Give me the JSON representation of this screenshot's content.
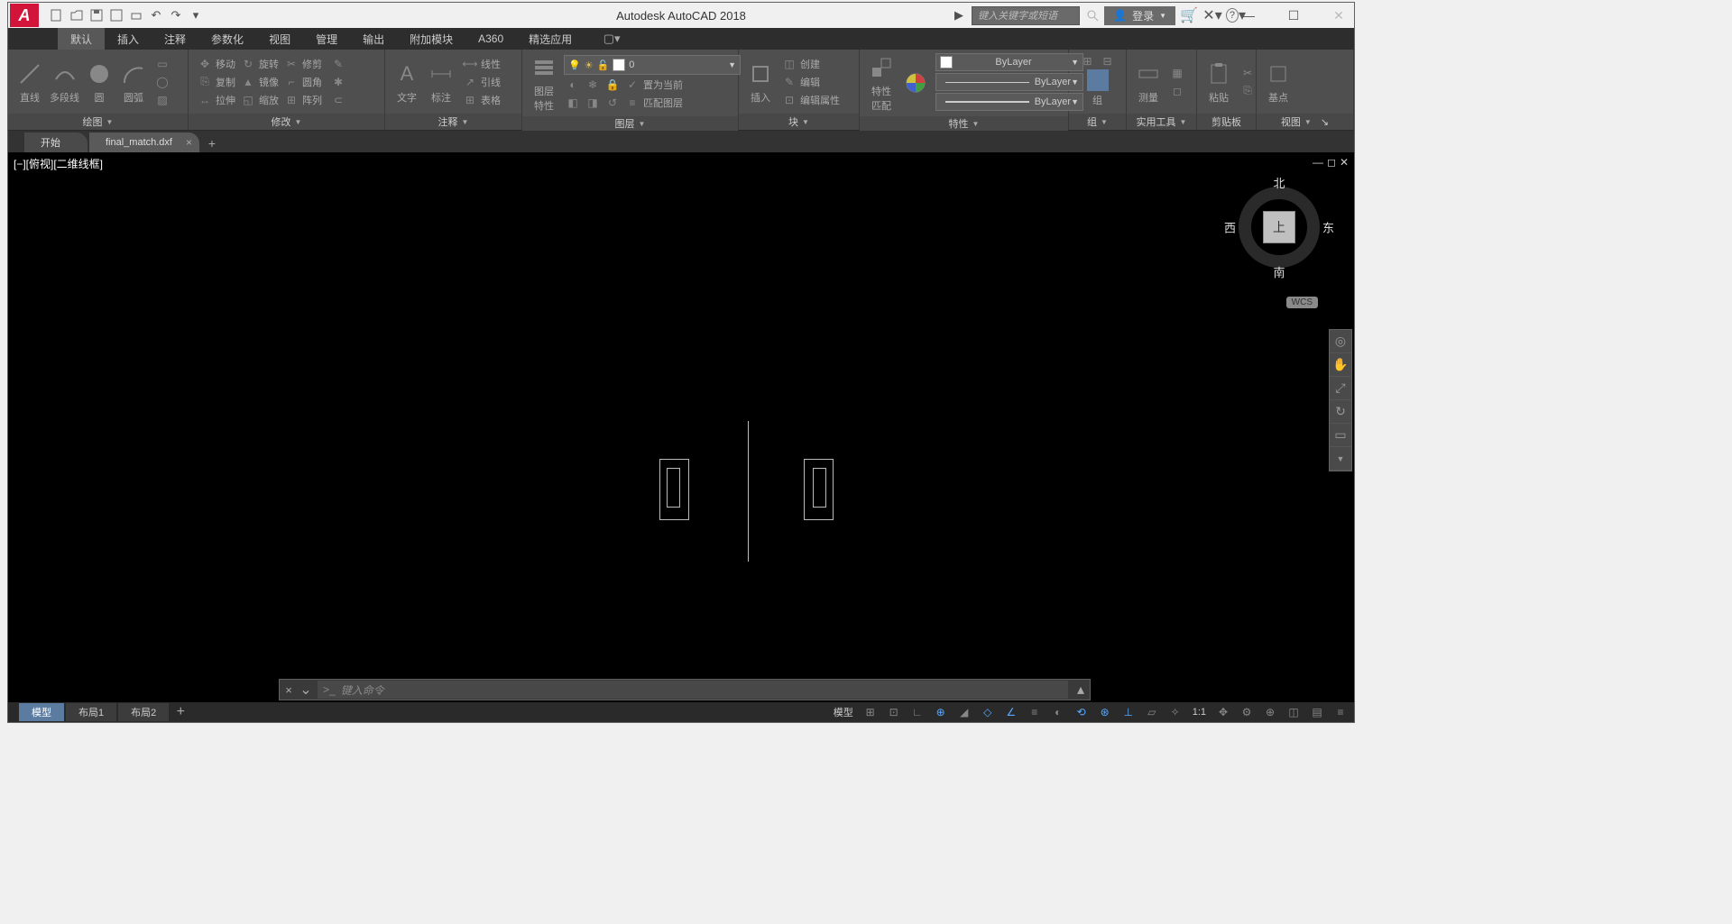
{
  "title": "Autodesk AutoCAD 2018",
  "search_placeholder": "键入关键字或短语",
  "login_label": "登录",
  "ribbon_tabs": [
    "默认",
    "插入",
    "注释",
    "参数化",
    "视图",
    "管理",
    "输出",
    "附加模块",
    "A360",
    "精选应用"
  ],
  "panels": {
    "draw": {
      "label": "绘图",
      "btns": {
        "line": "直线",
        "polyline": "多段线",
        "circle": "圆",
        "arc": "圆弧"
      }
    },
    "modify": {
      "label": "修改",
      "btns": {
        "move": "移动",
        "rotate": "旋转",
        "trim": "修剪",
        "copy": "复制",
        "mirror": "镜像",
        "fillet": "圆角",
        "stretch": "拉伸",
        "scale": "缩放",
        "array": "阵列"
      }
    },
    "annot": {
      "label": "注释",
      "btns": {
        "text": "文字",
        "dim": "标注",
        "leader": "引线",
        "table": "表格",
        "linear": "线性"
      }
    },
    "layer": {
      "label": "图层",
      "btns": {
        "props": "图层\n特性",
        "current": "置为当前",
        "edit": "匹配图层"
      },
      "combo_value": "0"
    },
    "block": {
      "label": "块",
      "btns": {
        "insert": "插入",
        "create": "创建",
        "edit": "编辑",
        "editattr": "编辑属性"
      }
    },
    "props": {
      "label": "特性",
      "btns": {
        "match": "特性\n匹配"
      },
      "combos": {
        "color": "ByLayer",
        "ltype": "ByLayer",
        "lweight": "ByLayer"
      }
    },
    "group": {
      "label": "组",
      "btn": "组"
    },
    "util": {
      "label": "实用工具",
      "btn": "测量"
    },
    "clip": {
      "label": "剪贴板",
      "btn": "粘贴"
    },
    "view": {
      "label": "视图",
      "btn": "基点"
    }
  },
  "file_tabs": {
    "start": "开始",
    "file": "final_match.dxf"
  },
  "viewport_label": "[−][俯视][二维线框]",
  "viewcube": {
    "top": "上",
    "n": "北",
    "s": "南",
    "e": "东",
    "w": "西",
    "wcs": "WCS"
  },
  "command": {
    "prompt": ">_",
    "placeholder": "键入命令"
  },
  "layout_tabs": [
    "模型",
    "布局1",
    "布局2"
  ],
  "status": {
    "model": "模型",
    "scale": "1:1"
  }
}
